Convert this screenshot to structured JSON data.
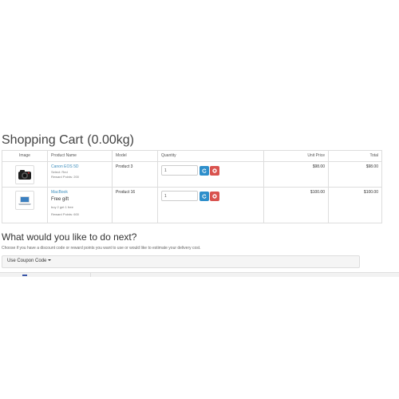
{
  "cart": {
    "title": "Shopping Cart",
    "weight": "(0.00kg)",
    "columns": {
      "image": "Image",
      "name": "Product Name",
      "model": "Model",
      "quantity": "Quantity",
      "unit_price": "Unit Price",
      "total": "Total"
    },
    "items": [
      {
        "name": "Canon EOS 5D",
        "option": "Select: Red",
        "reward_points": "Reward Points: 200",
        "model": "Product 3",
        "quantity": "1",
        "unit_price": "$98.00",
        "total": "$98.00",
        "image_icon": "camera-icon"
      },
      {
        "name": "MacBook",
        "gift": "Free gift",
        "offer": "buy 2 get 1 free",
        "reward_points": "Reward Points: 600",
        "model": "Product 16",
        "quantity": "1",
        "unit_price": "$100.00",
        "total": "$100.00",
        "image_icon": "laptop-icon"
      }
    ],
    "actions": {
      "update_icon": "refresh-icon",
      "remove_icon": "remove-icon"
    }
  },
  "next": {
    "title": "What would you like to do next?",
    "help": "Choose if you have a discount code or reward points you want to use or would like to estimate your delivery cost.",
    "coupon_label": "Use Coupon Code"
  },
  "colors": {
    "link": "#3c8dbc",
    "update_button": "#2e8fcb",
    "remove_button": "#d9534f",
    "panel": "#f5f5f5"
  }
}
